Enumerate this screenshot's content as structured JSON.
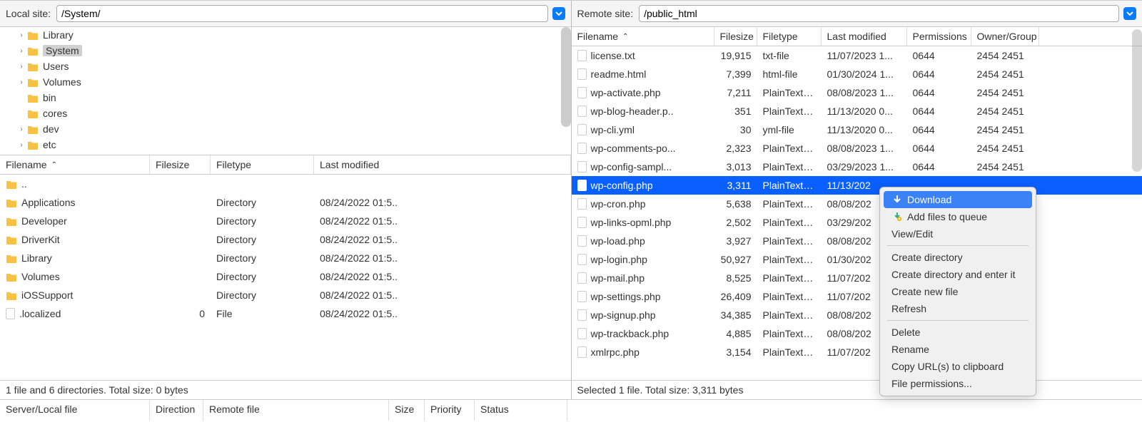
{
  "local": {
    "label": "Local site:",
    "path": "/System/",
    "tree": [
      {
        "label": "Library",
        "expandable": true,
        "selected": false
      },
      {
        "label": "System",
        "expandable": true,
        "selected": true
      },
      {
        "label": "Users",
        "expandable": true,
        "selected": false
      },
      {
        "label": "Volumes",
        "expandable": true,
        "selected": false
      },
      {
        "label": "bin",
        "expandable": false,
        "selected": false
      },
      {
        "label": "cores",
        "expandable": false,
        "selected": false
      },
      {
        "label": "dev",
        "expandable": true,
        "selected": false
      },
      {
        "label": "etc",
        "expandable": true,
        "selected": false
      }
    ],
    "headers": {
      "filename": "Filename",
      "filesize": "Filesize",
      "filetype": "Filetype",
      "lastmod": "Last modified"
    },
    "files": [
      {
        "name": "..",
        "size": "",
        "type": "",
        "mod": "",
        "icon": "folder"
      },
      {
        "name": "Applications",
        "size": "",
        "type": "Directory",
        "mod": "08/24/2022 01:5..",
        "icon": "folder"
      },
      {
        "name": "Developer",
        "size": "",
        "type": "Directory",
        "mod": "08/24/2022 01:5..",
        "icon": "folder"
      },
      {
        "name": "DriverKit",
        "size": "",
        "type": "Directory",
        "mod": "08/24/2022 01:5..",
        "icon": "folder"
      },
      {
        "name": "Library",
        "size": "",
        "type": "Directory",
        "mod": "08/24/2022 01:5..",
        "icon": "folder"
      },
      {
        "name": "Volumes",
        "size": "",
        "type": "Directory",
        "mod": "08/24/2022 01:5..",
        "icon": "folder"
      },
      {
        "name": "iOSSupport",
        "size": "",
        "type": "Directory",
        "mod": "08/24/2022 01:5..",
        "icon": "folder"
      },
      {
        "name": ".localized",
        "size": "0",
        "type": "File",
        "mod": "08/24/2022 01:5..",
        "icon": "file"
      }
    ],
    "status": "1 file and 6 directories. Total size: 0 bytes"
  },
  "remote": {
    "label": "Remote site:",
    "path": "/public_html",
    "headers": {
      "filename": "Filename",
      "filesize": "Filesize",
      "filetype": "Filetype",
      "lastmod": "Last modified",
      "perm": "Permissions",
      "owner": "Owner/Group"
    },
    "files": [
      {
        "name": "license.txt",
        "size": "19,915",
        "type": "txt-file",
        "mod": "11/07/2023 1...",
        "perm": "0644",
        "owner": "2454 2451",
        "selected": false
      },
      {
        "name": "readme.html",
        "size": "7,399",
        "type": "html-file",
        "mod": "01/30/2024 1...",
        "perm": "0644",
        "owner": "2454 2451",
        "selected": false
      },
      {
        "name": "wp-activate.php",
        "size": "7,211",
        "type": "PlainTextT...",
        "mod": "08/08/2023 1...",
        "perm": "0644",
        "owner": "2454 2451",
        "selected": false
      },
      {
        "name": "wp-blog-header.p..",
        "size": "351",
        "type": "PlainTextT...",
        "mod": "11/13/2020 0...",
        "perm": "0644",
        "owner": "2454 2451",
        "selected": false
      },
      {
        "name": "wp-cli.yml",
        "size": "30",
        "type": "yml-file",
        "mod": "11/13/2020 0...",
        "perm": "0644",
        "owner": "2454 2451",
        "selected": false
      },
      {
        "name": "wp-comments-po...",
        "size": "2,323",
        "type": "PlainTextT...",
        "mod": "08/08/2023 1...",
        "perm": "0644",
        "owner": "2454 2451",
        "selected": false
      },
      {
        "name": "wp-config-sampl...",
        "size": "3,013",
        "type": "PlainTextT...",
        "mod": "03/29/2023 1...",
        "perm": "0644",
        "owner": "2454 2451",
        "selected": false
      },
      {
        "name": "wp-config.php",
        "size": "3,311",
        "type": "PlainTextT...",
        "mod": "11/13/202",
        "perm": "",
        "owner": "",
        "selected": true
      },
      {
        "name": "wp-cron.php",
        "size": "5,638",
        "type": "PlainTextT...",
        "mod": "08/08/202",
        "perm": "",
        "owner": "",
        "selected": false
      },
      {
        "name": "wp-links-opml.php",
        "size": "2,502",
        "type": "PlainTextT...",
        "mod": "03/29/202",
        "perm": "",
        "owner": "",
        "selected": false
      },
      {
        "name": "wp-load.php",
        "size": "3,927",
        "type": "PlainTextT...",
        "mod": "08/08/202",
        "perm": "",
        "owner": "",
        "selected": false
      },
      {
        "name": "wp-login.php",
        "size": "50,927",
        "type": "PlainTextT...",
        "mod": "01/30/202",
        "perm": "",
        "owner": "",
        "selected": false
      },
      {
        "name": "wp-mail.php",
        "size": "8,525",
        "type": "PlainTextT...",
        "mod": "11/07/202",
        "perm": "",
        "owner": "",
        "selected": false
      },
      {
        "name": "wp-settings.php",
        "size": "26,409",
        "type": "PlainTextT...",
        "mod": "11/07/202",
        "perm": "",
        "owner": "",
        "selected": false
      },
      {
        "name": "wp-signup.php",
        "size": "34,385",
        "type": "PlainTextT...",
        "mod": "08/08/202",
        "perm": "",
        "owner": "",
        "selected": false
      },
      {
        "name": "wp-trackback.php",
        "size": "4,885",
        "type": "PlainTextT...",
        "mod": "08/08/202",
        "perm": "",
        "owner": "",
        "selected": false
      },
      {
        "name": "xmlrpc.php",
        "size": "3,154",
        "type": "PlainTextT...",
        "mod": "11/07/202",
        "perm": "",
        "owner": "",
        "selected": false
      }
    ],
    "status": "Selected 1 file. Total size: 3,311 bytes"
  },
  "context_menu": {
    "items": [
      {
        "label": "Download",
        "highlighted": true,
        "icon": "download"
      },
      {
        "label": "Add files to queue",
        "highlighted": false,
        "icon": "add"
      },
      {
        "label": "View/Edit",
        "highlighted": false,
        "icon": ""
      },
      {
        "sep": true
      },
      {
        "label": "Create directory",
        "highlighted": false,
        "icon": ""
      },
      {
        "label": "Create directory and enter it",
        "highlighted": false,
        "icon": ""
      },
      {
        "label": "Create new file",
        "highlighted": false,
        "icon": ""
      },
      {
        "label": "Refresh",
        "highlighted": false,
        "icon": ""
      },
      {
        "sep": true
      },
      {
        "label": "Delete",
        "highlighted": false,
        "icon": ""
      },
      {
        "label": "Rename",
        "highlighted": false,
        "icon": ""
      },
      {
        "label": "Copy URL(s) to clipboard",
        "highlighted": false,
        "icon": ""
      },
      {
        "label": "File permissions...",
        "highlighted": false,
        "icon": ""
      }
    ]
  },
  "bottom": {
    "server": "Server/Local file",
    "direction": "Direction",
    "remotefile": "Remote file",
    "size": "Size",
    "priority": "Priority",
    "status": "Status"
  }
}
